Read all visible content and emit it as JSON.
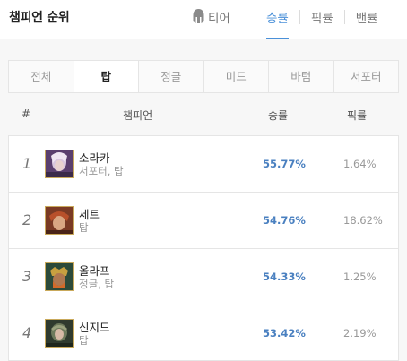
{
  "header": {
    "title": "챔피언 순위",
    "tabs": [
      {
        "label": "티어",
        "icon": "helmet-icon"
      },
      {
        "label": "승률"
      },
      {
        "label": "픽률"
      },
      {
        "label": "밴률"
      }
    ]
  },
  "positions": [
    "전체",
    "탑",
    "정글",
    "미드",
    "바텀",
    "서포터"
  ],
  "active_position": "탑",
  "table": {
    "headers": {
      "rank": "#",
      "champion": "챔피언",
      "winrate": "승률",
      "pickrate": "픽률"
    },
    "rows": [
      {
        "rank": "1",
        "name": "소라카",
        "positions": "서포터, 탑",
        "winrate": "55.77%",
        "pickrate": "1.64%"
      },
      {
        "rank": "2",
        "name": "세트",
        "positions": "탑",
        "winrate": "54.76%",
        "pickrate": "18.62%"
      },
      {
        "rank": "3",
        "name": "올라프",
        "positions": "정글, 탑",
        "winrate": "54.33%",
        "pickrate": "1.25%"
      },
      {
        "rank": "4",
        "name": "신지드",
        "positions": "탑",
        "winrate": "53.42%",
        "pickrate": "2.19%"
      }
    ]
  },
  "colors": {
    "accent": "#4a90d9",
    "winrate": "#4a80c0",
    "border": "#e5e5e5",
    "background": "#f7f7f7"
  }
}
